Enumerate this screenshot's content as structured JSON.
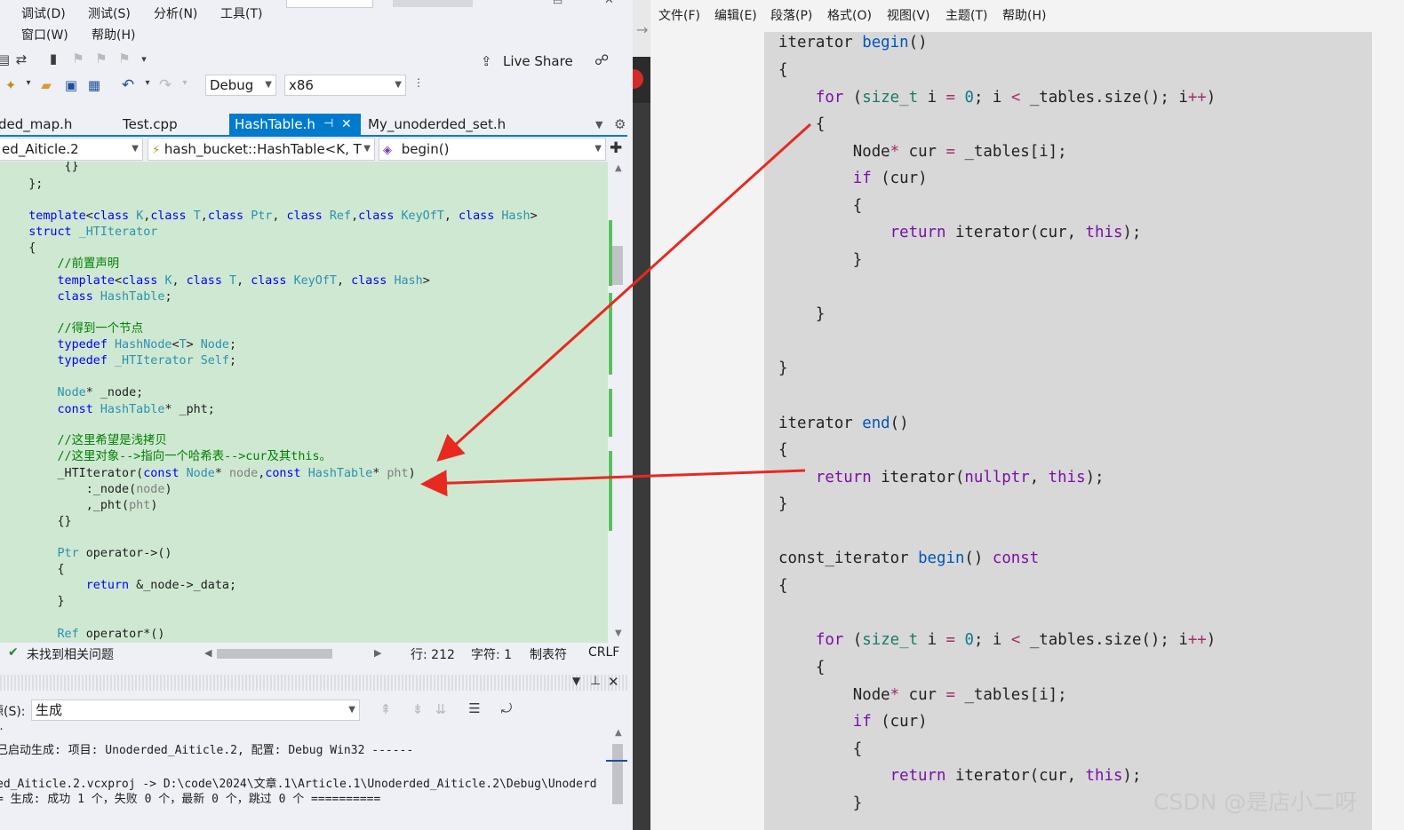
{
  "vs": {
    "menu": {
      "debug": "调试(D)",
      "test": "测试(S)",
      "analyze": "分析(N)",
      "tools": "工具(T)",
      "window": "窗口(W)",
      "help": "帮助(H)"
    },
    "live_share": "Live Share",
    "config_combo": "Debug",
    "platform_combo": "x86",
    "tabs": [
      "ded_map.h",
      "Test.cpp",
      "HashTable.h",
      "My_unoderded_set.h"
    ],
    "pin_glyph": "⊣",
    "close_glyph": "✕",
    "nav": {
      "project": "ed_Aiticle.2",
      "scope": "hash_bucket::HashTable<K, T",
      "member": "begin()"
    },
    "status": {
      "issues": "未找到相关问题",
      "line": "行: 212",
      "char": "字符: 1",
      "tab": "制表符",
      "eol": "CRLF"
    },
    "output": {
      "source_label": "源(S):",
      "source_value": "生成",
      "lines": [
        "已启动生成: 项目: Unoderded_Aiticle.2, 配置: Debug Win32 ------",
        "ed_Aiticle.2.vcxproj -> D:\\code\\2024\\文章.1\\Article.1\\Unoderded_Aiticle.2\\Debug\\Unoderd",
        "= 生成: 成功 1 个，失败 0 个，最新 0 个，跳过 0 个 =========="
      ]
    },
    "code": {
      "c_forward": "//前置声明",
      "c_node": "//得到一个节点",
      "c_shallow": "//这里希望是浅拷贝",
      "c_this": "//这里对象-->指向一个哈希表-->cur及其this。"
    }
  },
  "typora": {
    "menu": [
      "文件(F)",
      "编辑(E)",
      "段落(P)",
      "格式(O)",
      "视图(V)",
      "主题(T)",
      "帮助(H)"
    ],
    "watermark": "CSDN @是店小二呀"
  },
  "colors": {
    "accent": "#007acc",
    "editor_bg": "#cfe8d2",
    "arrow": "#e8291f"
  }
}
